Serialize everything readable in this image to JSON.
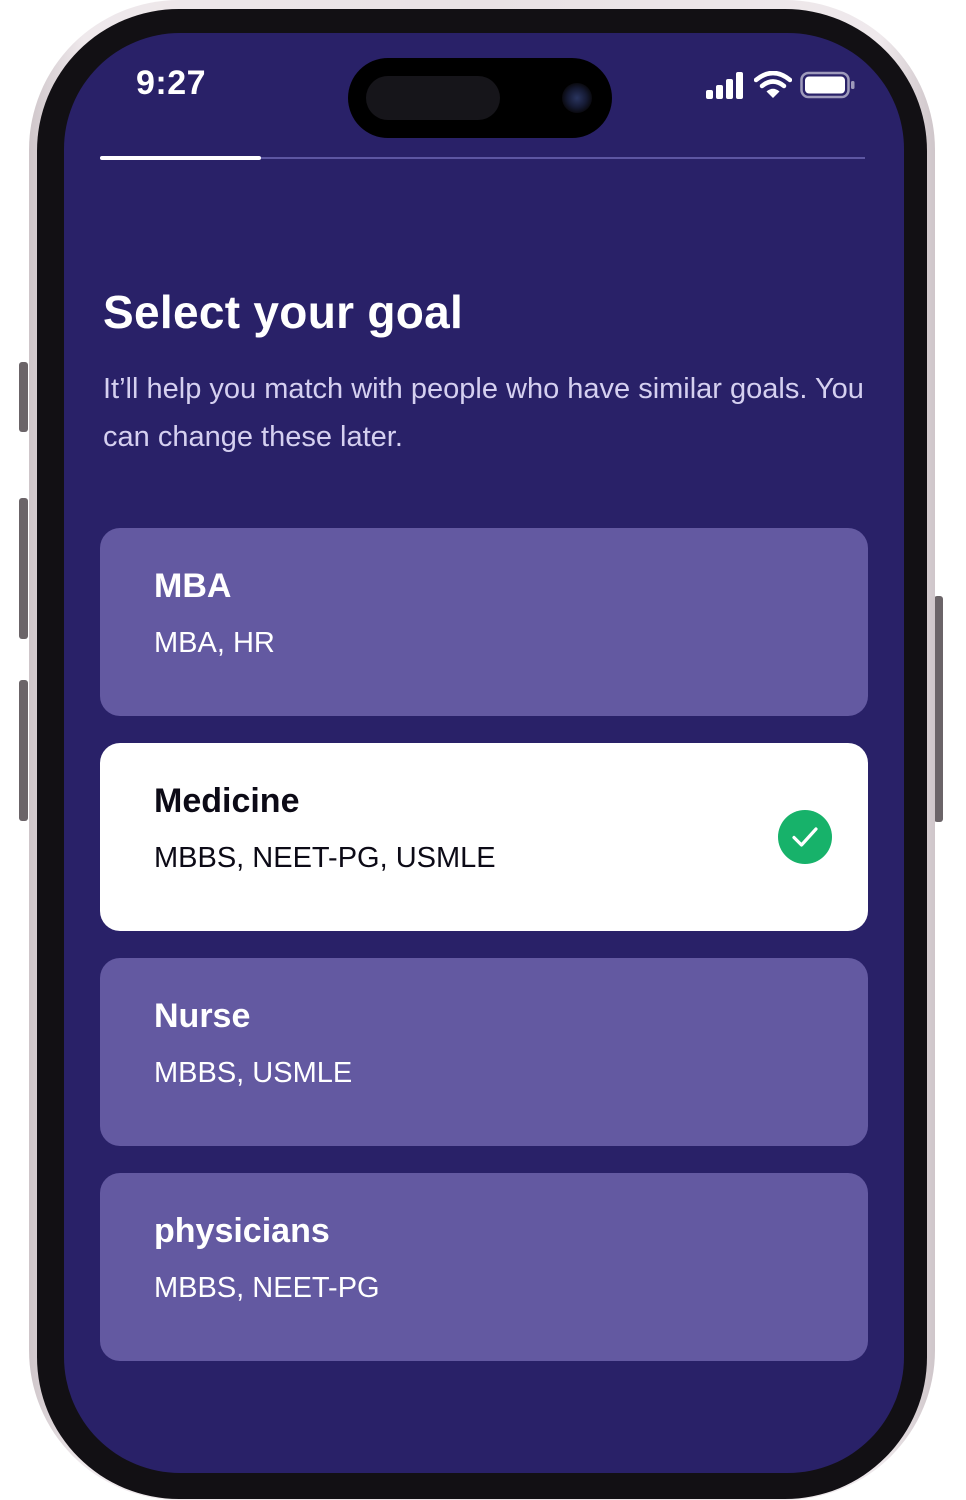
{
  "status_bar": {
    "time": "9:27",
    "icons": [
      "cellular-signal-icon",
      "wifi-icon",
      "battery-icon"
    ]
  },
  "progress": {
    "completed_fraction": 0.21
  },
  "header": {
    "title": "Select your goal",
    "subtitle": "It’ll help you match with people who have similar goals. You can change these later."
  },
  "goals": [
    {
      "name": "MBA",
      "exams": "MBA, HR",
      "selected": false
    },
    {
      "name": "Medicine",
      "exams": "MBBS, NEET-PG, USMLE",
      "selected": true
    },
    {
      "name": "Nurse",
      "exams": "MBBS, USMLE",
      "selected": false
    },
    {
      "name": "physicians",
      "exams": "MBBS, NEET-PG",
      "selected": false
    }
  ],
  "colors": {
    "background": "#292168",
    "card": "#6359a1",
    "card_selected": "#ffffff",
    "check_accent": "#17b26a",
    "progress_track": "#5d56a2",
    "subtitle_text": "#d5d0f0"
  }
}
